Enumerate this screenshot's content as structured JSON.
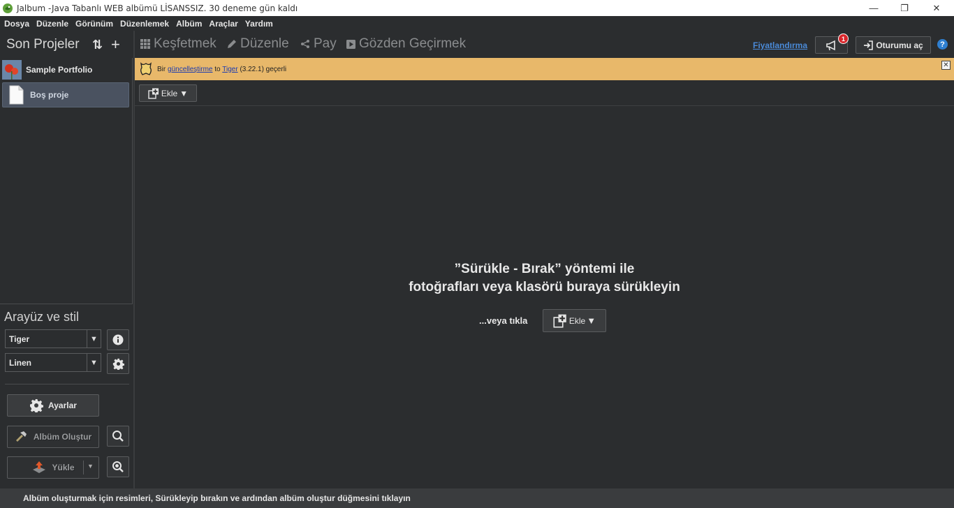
{
  "window": {
    "title": "Jalbum -Java Tabanlı WEB albümü LİSANSSIZ. 30 deneme gün kaldı",
    "minimize": "—",
    "restore": "❐",
    "close": "✕"
  },
  "menu": [
    "Dosya",
    "Düzenle",
    "Görünüm",
    "Düzenlemek",
    "Albüm",
    "Araçlar",
    "Yardım"
  ],
  "sidebar": {
    "projects_title": "Son Projeler",
    "sort_icon": "⇅",
    "add_icon": "+",
    "projects": [
      {
        "name": "Sample Portfolio",
        "selected": false
      },
      {
        "name": "Boş proje",
        "selected": true
      }
    ],
    "style_title": "Arayüz ve stil",
    "skin": "Tiger",
    "style": "Linen",
    "settings_label": "Ayarlar",
    "make_album_label": "Albüm Oluştur",
    "upload_label": "Yükle"
  },
  "toolbar": {
    "tabs": [
      "Keşfetmek",
      "Düzenle",
      "Pay",
      "Gözden Geçirmek"
    ],
    "pricing": "Fiyatlandırma",
    "badge_count": "1",
    "login": "Oturumu aç",
    "help": "?"
  },
  "notification": {
    "prefix": "Bir",
    "link1": "güncelleştirme",
    "mid": "to",
    "link2": "Tiger",
    "suffix": "(3.22.1) geçerli",
    "close": "✕"
  },
  "add_button": {
    "label": "Ekle",
    "arrow": "▼"
  },
  "drop": {
    "line1": "”Sürükle - Bırak” yöntemi ile",
    "line2": "fotoğrafları veya klasörü buraya sürükleyin",
    "or_click": "...veya tıkla",
    "add_label": "Ekle",
    "arrow": "▼"
  },
  "status": "Albüm oluşturmak için resimleri, Sürükleyip bırakın ve ardından albüm oluştur düğmesini tıklayın",
  "colors": {
    "background": "#2b2d2f",
    "notification": "#e8b86a",
    "link": "#4a8ad8",
    "badge": "#d9262b",
    "selected": "#4a5260"
  }
}
